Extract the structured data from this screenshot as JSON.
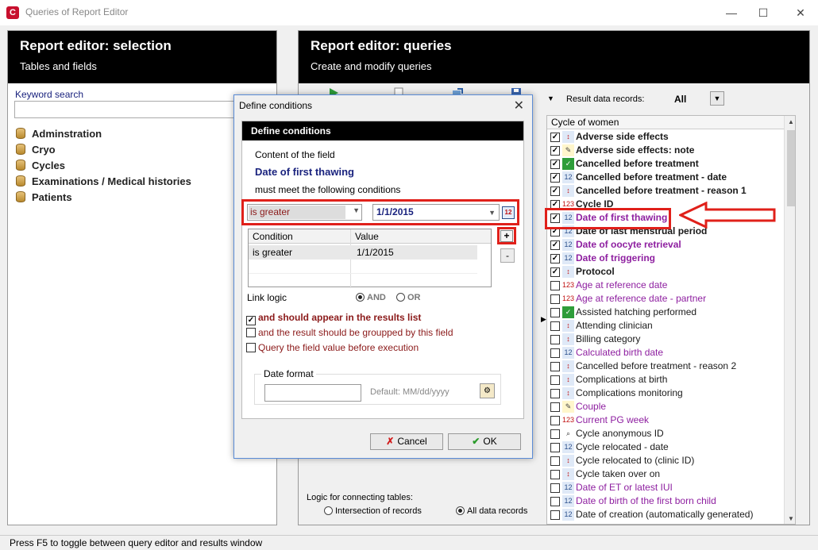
{
  "window": {
    "title": "Queries of Report Editor",
    "icon_letter": "C"
  },
  "left_panel": {
    "title": "Report editor: selection",
    "subtitle": "Tables and fields",
    "search_label": "Keyword search",
    "search_value": "",
    "tables": [
      "Adminstration",
      "Cryo",
      "Cycles",
      "Examinations / Medical histories",
      "Patients"
    ]
  },
  "right_panel": {
    "title": "Report editor: queries",
    "subtitle": "Create and modify queries",
    "result_records_label": "Result data records:",
    "result_records_value": "All",
    "field_list": {
      "header": "Cycle of women",
      "items": [
        {
          "label": "Adverse side effects",
          "checked": true,
          "bold": true,
          "icon": "range-icon"
        },
        {
          "label": "Adverse side effects: note",
          "checked": true,
          "bold": true,
          "icon": "note-icon"
        },
        {
          "label": "Cancelled before treatment",
          "checked": true,
          "bold": true,
          "icon": "checkmark-icon"
        },
        {
          "label": "Cancelled before treatment - date",
          "checked": true,
          "bold": true,
          "icon": "calendar-icon"
        },
        {
          "label": "Cancelled before treatment - reason 1",
          "checked": true,
          "bold": true,
          "icon": "range-icon"
        },
        {
          "label": "Cycle ID",
          "checked": true,
          "bold": true,
          "icon": "number-icon"
        },
        {
          "label": "Date of first thawing",
          "checked": true,
          "bold": true,
          "icon": "calendar-icon",
          "color": "#8e1fa0"
        },
        {
          "label": "Date of last menstrual period",
          "checked": true,
          "bold": true,
          "icon": "calendar-icon"
        },
        {
          "label": "Date of oocyte retrieval",
          "checked": true,
          "bold": true,
          "icon": "calendar-icon",
          "color": "#8e1fa0"
        },
        {
          "label": "Date of triggering",
          "checked": true,
          "bold": true,
          "icon": "calendar-icon",
          "color": "#8e1fa0"
        },
        {
          "label": "Protocol",
          "checked": true,
          "bold": true,
          "icon": "range-icon"
        },
        {
          "label": "Age at reference date",
          "checked": false,
          "bold": false,
          "icon": "number-icon",
          "color": "#8e1fa0"
        },
        {
          "label": "Age at reference date - partner",
          "checked": false,
          "bold": false,
          "icon": "number-icon",
          "color": "#8e1fa0"
        },
        {
          "label": "Assisted hatching performed",
          "checked": false,
          "bold": false,
          "icon": "checkmark-icon"
        },
        {
          "label": "Attending clinician",
          "checked": false,
          "bold": false,
          "icon": "range-icon"
        },
        {
          "label": "Billing category",
          "checked": false,
          "bold": false,
          "icon": "range-icon"
        },
        {
          "label": "Calculated birth date",
          "checked": false,
          "bold": false,
          "icon": "calendar-icon",
          "color": "#8e1fa0"
        },
        {
          "label": "Cancelled before treatment - reason 2",
          "checked": false,
          "bold": false,
          "icon": "range-icon"
        },
        {
          "label": "Complications at birth",
          "checked": false,
          "bold": false,
          "icon": "range-icon"
        },
        {
          "label": "Complications monitoring",
          "checked": false,
          "bold": false,
          "icon": "range-icon"
        },
        {
          "label": "Couple",
          "checked": false,
          "bold": false,
          "icon": "note-icon",
          "color": "#8e1fa0"
        },
        {
          "label": "Current PG week",
          "checked": false,
          "bold": false,
          "icon": "number-icon",
          "color": "#8e1fa0"
        },
        {
          "label": "Cycle anonymous ID",
          "checked": false,
          "bold": false,
          "icon": "search-icon"
        },
        {
          "label": "Cycle relocated - date",
          "checked": false,
          "bold": false,
          "icon": "calendar-icon"
        },
        {
          "label": "Cycle relocated to (clinic ID)",
          "checked": false,
          "bold": false,
          "icon": "range-icon"
        },
        {
          "label": "Cycle taken over on",
          "checked": false,
          "bold": false,
          "icon": "range-icon"
        },
        {
          "label": "Date of ET or latest IUI",
          "checked": false,
          "bold": false,
          "icon": "calendar-icon",
          "color": "#8e1fa0"
        },
        {
          "label": "Date of birth of the first born child",
          "checked": false,
          "bold": false,
          "icon": "calendar-icon",
          "color": "#8e1fa0"
        },
        {
          "label": "Date of creation (automatically generated)",
          "checked": false,
          "bold": false,
          "icon": "calendar-icon"
        }
      ]
    },
    "logic": {
      "label": "Logic for connecting tables:",
      "option_intersection": "Intersection of records",
      "option_all": "All data records",
      "selected": "All data records"
    }
  },
  "dialog": {
    "title": "Define conditions",
    "header": "Define conditions",
    "content_label": "Content of the field",
    "field_name": "Date of first thawing",
    "must_meet": "must meet the following conditions",
    "condition_operator": "is greater",
    "condition_value": "1/1/2015",
    "table": {
      "col_condition": "Condition",
      "col_value": "Value",
      "rows": [
        {
          "condition": "is greater",
          "value": "1/1/2015"
        }
      ]
    },
    "plus": "+",
    "minus": "-",
    "link_logic_label": "Link logic",
    "link_and": "AND",
    "link_or": "OR",
    "link_selected": "AND",
    "chk_results": {
      "label": "and should appear in the results list",
      "checked": true
    },
    "chk_grouped": {
      "label": "and the result should be groupped by this field",
      "checked": false
    },
    "chk_query": {
      "label": "Query the field value before execution",
      "checked": false
    },
    "date_format_label": "Date format",
    "date_format_value": "",
    "date_format_hint": "Default: MM/dd/yyyy",
    "cancel_label": "Cancel",
    "ok_label": "OK"
  },
  "statusbar": "Press F5 to toggle between query editor and results window",
  "colors": {
    "highlight": "#e0201a",
    "accent_text": "#1a237e",
    "condition_text": "#8b1a1a",
    "purple_field": "#8e1fa0"
  }
}
